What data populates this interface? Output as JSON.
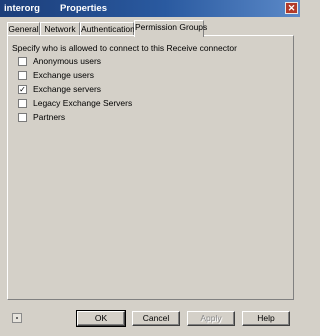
{
  "window": {
    "name": "interorg",
    "title": "Properties",
    "close_label": "✕"
  },
  "tabs": [
    {
      "label": "General"
    },
    {
      "label": "Network"
    },
    {
      "label": "Authentication"
    },
    {
      "label": "Permission Groups"
    }
  ],
  "permission_groups": {
    "instruction": "Specify who is allowed to connect to this Receive connector",
    "options": [
      {
        "label": "Anonymous users",
        "checked": false
      },
      {
        "label": "Exchange users",
        "checked": false
      },
      {
        "label": "Exchange servers",
        "checked": true,
        "mark": "✓"
      },
      {
        "label": "Legacy Exchange Servers",
        "checked": false
      },
      {
        "label": "Partners",
        "checked": false
      }
    ]
  },
  "buttons": {
    "ok": "OK",
    "cancel": "Cancel",
    "apply": "Apply",
    "help": "Help"
  },
  "footer": {
    "icon": "dialog-info-icon"
  },
  "colors": {
    "title_start": "#1c3e7a",
    "title_end": "#5b89c8",
    "face": "#d4d0c8"
  }
}
